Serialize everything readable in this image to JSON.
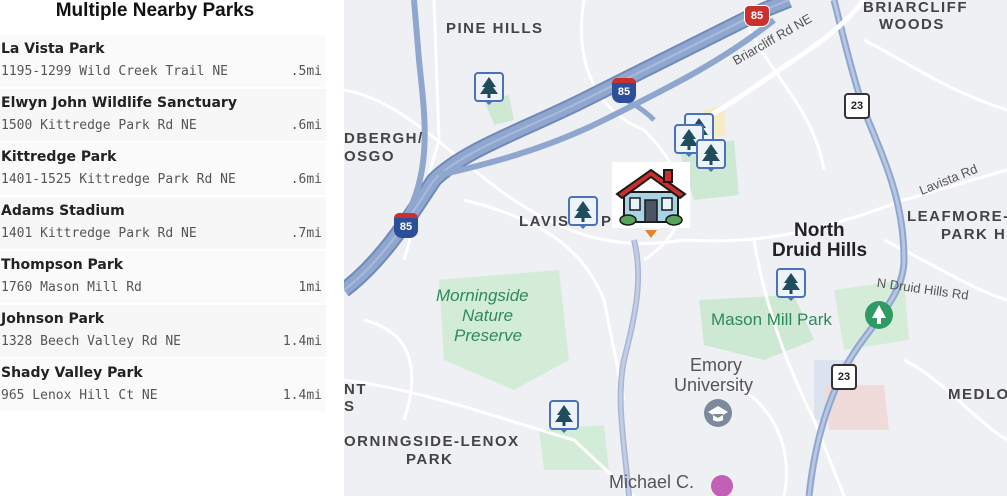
{
  "panel": {
    "title": "Multiple Nearby Parks",
    "parks": [
      {
        "name": "La Vista Park",
        "address": "1195-1299 Wild Creek Trail NE",
        "distance": ".5mi"
      },
      {
        "name": "Elwyn John Wildlife Sanctuary",
        "address": "1500 Kittredge Park Rd NE",
        "distance": ".6mi"
      },
      {
        "name": "Kittredge Park",
        "address": "1401-1525 Kittredge Park Rd NE",
        "distance": ".6mi"
      },
      {
        "name": "Adams Stadium",
        "address": "1401 Kittredge Park Rd NE",
        "distance": ".7mi"
      },
      {
        "name": "Thompson Park",
        "address": "1760 Mason Mill Rd",
        "distance": "1mi"
      },
      {
        "name": "Johnson Park",
        "address": "1328 Beech Valley Rd NE",
        "distance": "1.4mi"
      },
      {
        "name": "Shady Valley Park",
        "address": "965 Lenox Hill Ct NE",
        "distance": "1.4mi"
      }
    ]
  },
  "map": {
    "labels": {
      "pine_hills": "PINE HILLS",
      "briarcliff_woods_1": "BRIARCLIFF",
      "briarcliff_woods_2": "WOODS",
      "lindbergh_1": "DBERGH/",
      "lindbergh_2": "OSGO",
      "lavista_partial": "LAVIS",
      "lavista_p": "P",
      "leafmore_1": "LEAFMORE-",
      "leafmore_2": "PARK H",
      "north_druid_1": "North",
      "north_druid_2": "Druid Hills",
      "morningside_1": "Morningside",
      "morningside_2": "Nature",
      "morningside_3": "Preserve",
      "mason_mill": "Mason Mill Park",
      "emory_1": "Emory",
      "emory_2": "University",
      "medlock": "MEDLO",
      "nt_1": "NT",
      "nt_2": "S",
      "lenox_1": "ORNINGSIDE-LENOX",
      "lenox_2": "PARK",
      "michael": "Michael C.",
      "briarcliff_rd": "Briarcliff Rd NE",
      "lavista_rd": "Lavista Rd",
      "n_druid_rd": "N Druid Hills Rd"
    },
    "shields": {
      "i85_top": "85",
      "i85_mid": "85",
      "i85_left": "85",
      "us23_top": "23",
      "us23_bottom": "23"
    },
    "icons": {
      "home": "house-icon",
      "park": "tree-icon"
    },
    "colors": {
      "highway": "#8fa7cf",
      "highway_edge": "#6f89b8",
      "park_green": "#cde9d3",
      "park_text": "#2f8a5a",
      "marker_blue": "#4a72b8"
    }
  }
}
